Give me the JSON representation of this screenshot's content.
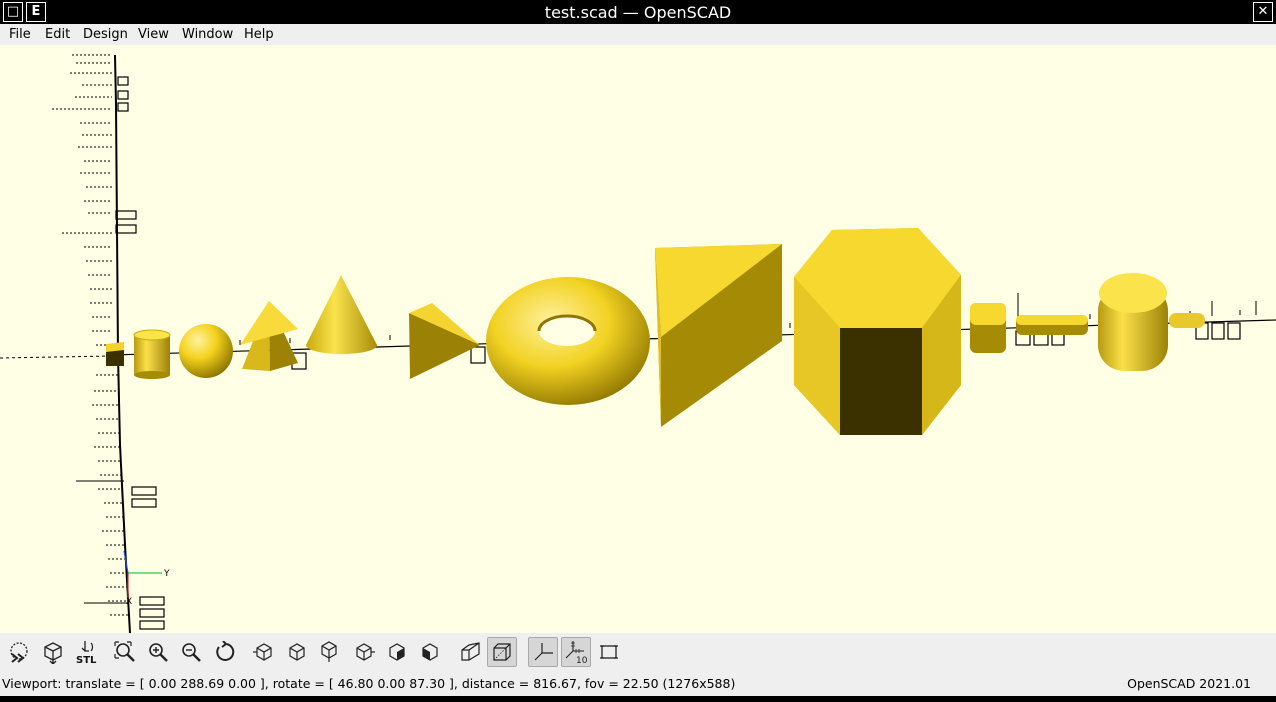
{
  "window": {
    "title": "test.scad — OpenSCAD",
    "left_buttons": [
      "□",
      "E"
    ],
    "close_glyph": "✕"
  },
  "menubar": {
    "items": [
      "File",
      "Edit",
      "Design",
      "View",
      "Window",
      "Help"
    ]
  },
  "viewport": {
    "background": "#ffffe5",
    "model_color": "#f9d72c",
    "axis_labels": [
      "Y",
      "X"
    ]
  },
  "toolbar": {
    "buttons": [
      {
        "name": "preview",
        "icon": "preview-icon"
      },
      {
        "name": "render",
        "icon": "render-icon"
      },
      {
        "name": "export-stl",
        "icon": "stl-export-icon",
        "text": "STL"
      },
      {
        "name": "view-all",
        "icon": "zoom-all-icon"
      },
      {
        "name": "zoom-in",
        "icon": "zoom-in-icon"
      },
      {
        "name": "zoom-out",
        "icon": "zoom-out-icon"
      },
      {
        "name": "reset-view",
        "icon": "reset-view-icon"
      },
      {
        "name": "view-right",
        "icon": "view-right-icon"
      },
      {
        "name": "view-top",
        "icon": "view-top-icon"
      },
      {
        "name": "view-bottom",
        "icon": "view-bottom-icon"
      },
      {
        "name": "view-left",
        "icon": "view-left-icon"
      },
      {
        "name": "view-front",
        "icon": "view-front-icon"
      },
      {
        "name": "view-back",
        "icon": "view-back-icon"
      },
      {
        "name": "perspective",
        "icon": "perspective-icon"
      },
      {
        "name": "orthogonal",
        "icon": "orthogonal-icon",
        "active": true
      },
      {
        "name": "show-axes",
        "icon": "axes-icon",
        "active": true
      },
      {
        "name": "show-scale",
        "icon": "scale-markers-icon",
        "text": "10",
        "active": true
      },
      {
        "name": "show-edges",
        "icon": "edges-icon"
      }
    ]
  },
  "statusbar": {
    "viewport_info": "Viewport: translate = [ 0.00 288.69 0.00 ], rotate = [ 46.80 0.00 87.30 ], distance = 816.67, fov = 22.50 (1276x588)",
    "version": "OpenSCAD 2021.01"
  }
}
